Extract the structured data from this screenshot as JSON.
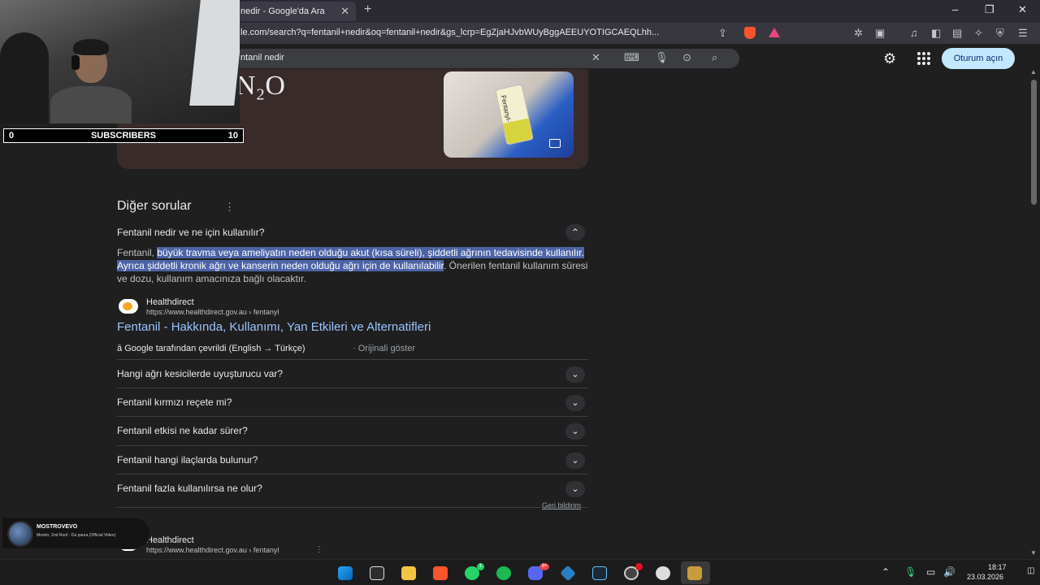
{
  "browser": {
    "tab_title": "nedir - Google'da Ara",
    "tab_close": "✕",
    "new_tab": "+",
    "url": "le.com/search?q=fentanil+nedir&oq=fentanil+nedir&gs_lcrp=EgZjaHJvbWUyBggAEEUYOTIGCAEQLhh...",
    "window_controls": [
      "–",
      "❐",
      "✕"
    ]
  },
  "google": {
    "search_value": "ntanil nedir",
    "signin_label": "Oturum açın"
  },
  "panel": {
    "formula": "N₂O",
    "image_label": "Fentanyl-Test"
  },
  "section": {
    "title": "Diğer sorular",
    "open_question": "Fentanil nedir ve ne için kullanılır?",
    "answer_prefix": "Fentanil, ",
    "answer_highlight": "büyük travma veya ameliyatın neden olduğu akut (kısa süreli), şiddetli ağrının tedavisinde kullanılır.  Ayrıca şiddetli kronik ağrı ve kanserin neden olduğu ağrı için de kullanılabilir",
    "answer_suffix": ". Önerilen fentanil kullanım süresi ve dozu, kullanım amacınıza bağlı olacaktır.",
    "source_name": "Healthdirect",
    "source_url": "https://www.healthdirect.gov.au › fentanyl",
    "result_link": "Fentanil - Hakkında, Kullanımı, Yan Etkileri ve Alternatifleri",
    "translated_note": "Google tarafından çevrildi (English → Türkçe)",
    "show_original": "Orijinali göster",
    "questions": [
      "Hangi ağrı kesicilerde uyuşturucu var?",
      "Fentanil kırmızı reçete mi?",
      "Fentanil etkisi ne kadar sürer?",
      "Fentanil hangi ilaçlarda bulunur?",
      "Fentanil fazla kullanılırsa ne olur?"
    ],
    "feedback": "Geri bildirim",
    "source2_name": "Healthdirect",
    "source2_url": "https://www.healthdirect.gov.au › fentanyl"
  },
  "overlay": {
    "subs_left": "0",
    "subs_label": "SUBSCRIBERS",
    "subs_right": "10",
    "music_title": "MOSTROVEVO",
    "music_sub": "Mostro, 2nd Roof - Da paura (Official Video)"
  },
  "taskbar": {
    "time": "18:17",
    "date": "23.03.2026",
    "whatsapp_badge": "1",
    "discord_badge": "9+"
  },
  "colors": {
    "accent_link": "#99c3ff",
    "highlight": "#4c63a6",
    "signin_bg": "#c2e7ff"
  }
}
